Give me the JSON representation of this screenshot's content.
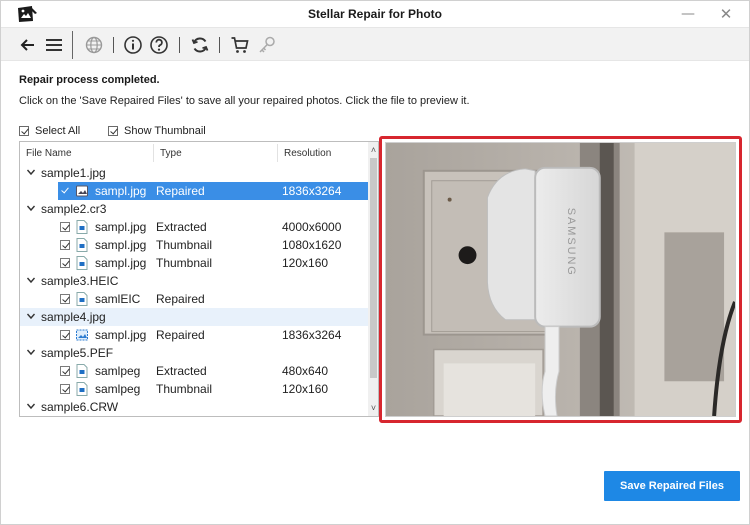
{
  "window": {
    "title": "Stellar Repair for Photo",
    "minimize_glyph": "—",
    "close_glyph": "✕"
  },
  "toolbar": {
    "items": [
      {
        "name": "back",
        "icon": "arrow-left-icon"
      },
      {
        "name": "menu",
        "icon": "hamburger-menu-icon"
      },
      {
        "name": "language",
        "icon": "globe-icon"
      },
      {
        "name": "info",
        "icon": "info-icon"
      },
      {
        "name": "help",
        "icon": "help-icon"
      },
      {
        "name": "update",
        "icon": "refresh-icon"
      },
      {
        "name": "buy",
        "icon": "cart-icon"
      },
      {
        "name": "activate",
        "icon": "key-icon"
      }
    ]
  },
  "message": {
    "title": "Repair process completed.",
    "subtitle": "Click on the 'Save Repaired Files' to save all your repaired photos. Click the file to preview it."
  },
  "options": {
    "select_all": {
      "label": "Select All",
      "checked": true
    },
    "show_thumbnail": {
      "label": "Show Thumbnail",
      "checked": true
    }
  },
  "tree": {
    "columns": [
      "File Name",
      "Type",
      "Resolution"
    ],
    "groups": [
      {
        "name": "sample1.jpg",
        "files": [
          {
            "name": "sampl.jpg",
            "type": "Repaired",
            "resolution": "1836x3264",
            "checked": true,
            "selected": true,
            "icon": "image-file-icon"
          }
        ]
      },
      {
        "name": "sample2.cr3",
        "files": [
          {
            "name": "sampl.jpg",
            "type": "Extracted",
            "resolution": "4000x6000",
            "checked": true,
            "icon": "file-icon"
          },
          {
            "name": "sampl.jpg",
            "type": "Thumbnail",
            "resolution": "1080x1620",
            "checked": true,
            "icon": "file-icon"
          },
          {
            "name": "sampl.jpg",
            "type": "Thumbnail",
            "resolution": "120x160",
            "checked": true,
            "icon": "file-icon"
          }
        ]
      },
      {
        "name": "sample3.HEIC",
        "files": [
          {
            "name": "samlEIC",
            "type": "Repaired",
            "resolution": "",
            "checked": true,
            "icon": "file-icon"
          }
        ]
      },
      {
        "name": "sample4.jpg",
        "highlighted": true,
        "files": [
          {
            "name": "sampl.jpg",
            "type": "Repaired",
            "resolution": "1836x3264",
            "checked": true,
            "icon": "image-preview-icon"
          }
        ]
      },
      {
        "name": "sample5.PEF",
        "files": [
          {
            "name": "samlpeg",
            "type": "Extracted",
            "resolution": "480x640",
            "checked": true,
            "icon": "file-icon"
          },
          {
            "name": "samlpeg",
            "type": "Thumbnail",
            "resolution": "120x160",
            "checked": true,
            "icon": "file-icon"
          }
        ]
      },
      {
        "name": "sample6.CRW",
        "files": []
      }
    ]
  },
  "preview": {
    "description": "Preview of selected repaired photo (charger plugged into wall socket)",
    "brand_text": "SAMSUNG",
    "highlight_color": "#d7262f"
  },
  "actions": {
    "save_label": "Save Repaired Files",
    "accent_color": "#1e88e5"
  }
}
